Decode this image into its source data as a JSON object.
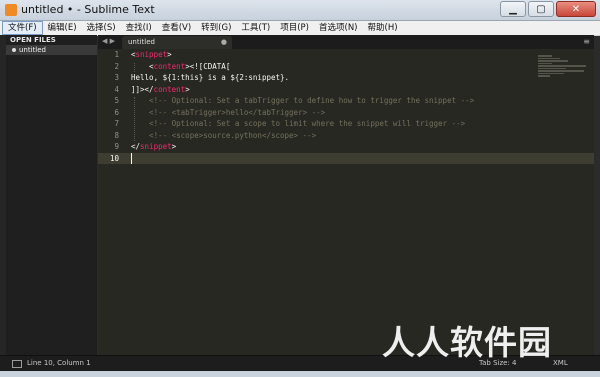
{
  "window": {
    "title": "untitled • - Sublime Text",
    "controls": {
      "minimize": "▁",
      "maximize": "▢",
      "close": "✕"
    }
  },
  "menu": [
    {
      "label": "文件(F)"
    },
    {
      "label": "编辑(E)"
    },
    {
      "label": "选择(S)"
    },
    {
      "label": "查找(I)"
    },
    {
      "label": "查看(V)"
    },
    {
      "label": "转到(G)"
    },
    {
      "label": "工具(T)"
    },
    {
      "label": "项目(P)"
    },
    {
      "label": "首选项(N)"
    },
    {
      "label": "帮助(H)"
    }
  ],
  "sidebar": {
    "header": "OPEN FILES",
    "files": [
      {
        "name": "untitled"
      }
    ]
  },
  "tabs": {
    "nav_prev": "◀",
    "nav_next": "▶",
    "items": [
      {
        "label": "untitled",
        "close": "●"
      }
    ],
    "menu_icon": "≡"
  },
  "editor": {
    "line_numbers": [
      "1",
      "2",
      "3",
      "4",
      "5",
      "6",
      "7",
      "8",
      "9",
      "10"
    ],
    "active_line": 10,
    "lines": [
      {
        "segments": [
          {
            "t": "<",
            "c": "plain"
          },
          {
            "t": "snippet",
            "c": "tag"
          },
          {
            "t": ">",
            "c": "plain"
          }
        ]
      },
      {
        "segments": [
          {
            "t": "    <",
            "c": "plain"
          },
          {
            "t": "content",
            "c": "tag"
          },
          {
            "t": "><![CDATA[",
            "c": "plain"
          }
        ]
      },
      {
        "segments": [
          {
            "t": "Hello, ${1:this} is a ${2:snippet}.",
            "c": "plain"
          }
        ]
      },
      {
        "segments": [
          {
            "t": "]]></",
            "c": "plain"
          },
          {
            "t": "content",
            "c": "tag"
          },
          {
            "t": ">",
            "c": "plain"
          }
        ]
      },
      {
        "segments": [
          {
            "t": "    <!-- Optional: Set a tabTrigger to define how to trigger the snippet -->",
            "c": "cm"
          }
        ]
      },
      {
        "segments": [
          {
            "t": "    <!-- <tabTrigger>hello</tabTrigger> -->",
            "c": "cm"
          }
        ]
      },
      {
        "segments": [
          {
            "t": "    <!-- Optional: Set a scope to limit where the snippet will trigger -->",
            "c": "cm"
          }
        ]
      },
      {
        "segments": [
          {
            "t": "    <!-- <scope>source.python</scope> -->",
            "c": "cm"
          }
        ]
      },
      {
        "segments": [
          {
            "t": "</",
            "c": "plain"
          },
          {
            "t": "snippet",
            "c": "tag"
          },
          {
            "t": ">",
            "c": "plain"
          }
        ]
      },
      {
        "segments": [
          {
            "t": "",
            "c": "plain"
          }
        ]
      }
    ]
  },
  "status": {
    "position": "Line 10, Column 1",
    "tab_size": "Tab Size: 4",
    "syntax": "XML"
  },
  "watermark": "人人软件园",
  "colors": {
    "tag": "#f92672",
    "comment": "#75715e",
    "text": "#f8f8f2",
    "editor_bg": "#272822",
    "line_highlight": "#3e3d32"
  },
  "icons": {
    "app": "sublime-logo-icon",
    "status": "panel-toggle-icon"
  }
}
